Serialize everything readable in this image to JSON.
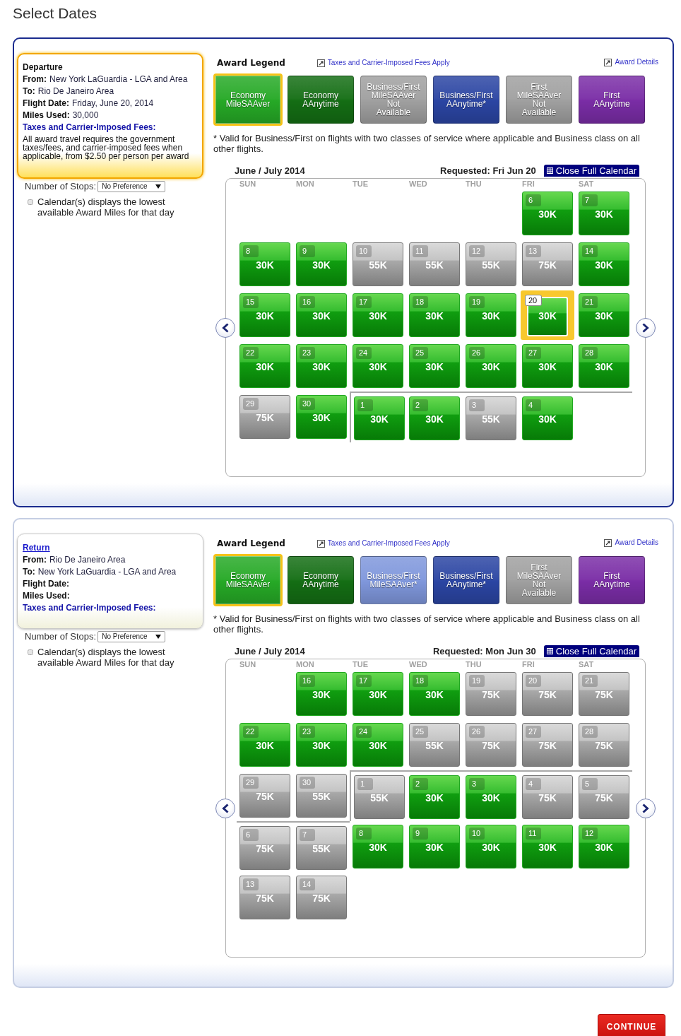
{
  "page": {
    "title": "Select Dates"
  },
  "sections": [
    {
      "selected": true,
      "info": {
        "heading": {
          "text": "Departure",
          "link": false
        },
        "fields": [
          {
            "label": "From:",
            "value": "New York LaGuardia - LGA and Area"
          },
          {
            "label": "To:",
            "value": "Rio De Janeiro Area"
          },
          {
            "label": "Flight Date:",
            "value": "Friday, June 20, 2014"
          },
          {
            "label": "Miles Used:",
            "value": "30,000"
          }
        ],
        "fees_label": "Taxes and Carrier-Imposed Fees:",
        "fees_note": "All award travel requires the government taxes/fees, and carrier-imposed fees when applicable, from $2.50 per person per award"
      },
      "stops": {
        "label": "Number of Stops:",
        "value": "No Preference"
      },
      "lowest_option": {
        "checked": false,
        "text": "Calendar(s) displays the lowest available Award Miles for that day"
      },
      "legend": {
        "title": "Award Legend",
        "fees_link": "Taxes and Carrier-Imposed Fees Apply",
        "details_link": "Award Details",
        "tiles": [
          {
            "label": "Economy MileSAAver",
            "color": "#26a926",
            "selected": true
          },
          {
            "label": "Economy AAnytime",
            "color": "#146e14",
            "selected": false
          },
          {
            "label": "Business/First MileSAAver Not Available",
            "color": "#a0a0a0",
            "selected": false
          },
          {
            "label": "Business/First AAnytime*",
            "color": "#2b45a3",
            "selected": false
          },
          {
            "label": "First MileSAAver Not Available",
            "color": "#a0a0a0",
            "selected": false
          },
          {
            "label": "First AAnytime",
            "color": "#7a2da6",
            "selected": false
          }
        ],
        "footnote": "* Valid for Business/First on flights with two classes of service where applicable and Business class on all other flights."
      },
      "calendar": {
        "title": "June / July 2014",
        "requested": "Requested: Fri Jun 20",
        "close_button": "Close Full Calendar",
        "weekdays": [
          "SUN",
          "MON",
          "TUE",
          "WED",
          "THU",
          "FRI",
          "SAT"
        ],
        "months": [
          {
            "days": [
              {
                "kind": "empty"
              },
              {
                "kind": "empty"
              },
              {
                "kind": "empty"
              },
              {
                "kind": "empty"
              },
              {
                "kind": "empty"
              },
              {
                "kind": "day",
                "day": "6",
                "miles": "30K",
                "saver": true,
                "selected": false
              },
              {
                "kind": "day",
                "day": "7",
                "miles": "30K",
                "saver": true,
                "selected": false
              },
              {
                "kind": "day",
                "day": "8",
                "miles": "30K",
                "saver": true,
                "selected": false
              },
              {
                "kind": "day",
                "day": "9",
                "miles": "30K",
                "saver": true,
                "selected": false
              },
              {
                "kind": "day",
                "day": "10",
                "miles": "55K",
                "saver": false,
                "selected": false
              },
              {
                "kind": "day",
                "day": "11",
                "miles": "55K",
                "saver": false,
                "selected": false
              },
              {
                "kind": "day",
                "day": "12",
                "miles": "55K",
                "saver": false,
                "selected": false
              },
              {
                "kind": "day",
                "day": "13",
                "miles": "75K",
                "saver": false,
                "selected": false
              },
              {
                "kind": "day",
                "day": "14",
                "miles": "30K",
                "saver": true,
                "selected": false
              },
              {
                "kind": "day",
                "day": "15",
                "miles": "30K",
                "saver": true,
                "selected": false
              },
              {
                "kind": "day",
                "day": "16",
                "miles": "30K",
                "saver": true,
                "selected": false
              },
              {
                "kind": "day",
                "day": "17",
                "miles": "30K",
                "saver": true,
                "selected": false
              },
              {
                "kind": "day",
                "day": "18",
                "miles": "30K",
                "saver": true,
                "selected": false
              },
              {
                "kind": "day",
                "day": "19",
                "miles": "30K",
                "saver": true,
                "selected": false
              },
              {
                "kind": "day",
                "day": "20",
                "miles": "30K",
                "saver": true,
                "selected": true
              },
              {
                "kind": "day",
                "day": "21",
                "miles": "30K",
                "saver": true,
                "selected": false
              },
              {
                "kind": "day",
                "day": "22",
                "miles": "30K",
                "saver": true,
                "selected": false
              },
              {
                "kind": "day",
                "day": "23",
                "miles": "30K",
                "saver": true,
                "selected": false
              },
              {
                "kind": "day",
                "day": "24",
                "miles": "30K",
                "saver": true,
                "selected": false
              },
              {
                "kind": "day",
                "day": "25",
                "miles": "30K",
                "saver": true,
                "selected": false
              },
              {
                "kind": "day",
                "day": "26",
                "miles": "30K",
                "saver": true,
                "selected": false
              },
              {
                "kind": "day",
                "day": "27",
                "miles": "30K",
                "saver": true,
                "selected": false
              },
              {
                "kind": "day",
                "day": "28",
                "miles": "30K",
                "saver": true,
                "selected": false
              },
              {
                "kind": "day",
                "day": "29",
                "miles": "75K",
                "saver": false,
                "selected": false
              },
              {
                "kind": "day",
                "day": "30",
                "miles": "30K",
                "saver": true,
                "selected": false
              }
            ]
          },
          {
            "days": [
              {
                "kind": "day",
                "day": "1",
                "miles": "30K",
                "saver": true,
                "selected": false
              },
              {
                "kind": "day",
                "day": "2",
                "miles": "30K",
                "saver": true,
                "selected": false
              },
              {
                "kind": "day",
                "day": "3",
                "miles": "55K",
                "saver": false,
                "selected": false
              },
              {
                "kind": "day",
                "day": "4",
                "miles": "30K",
                "saver": true,
                "selected": false
              }
            ]
          }
        ]
      }
    },
    {
      "selected": false,
      "info": {
        "heading": {
          "text": "Return",
          "link": true
        },
        "fields": [
          {
            "label": "From:",
            "value": "Rio De Janeiro Area"
          },
          {
            "label": "To:",
            "value": "New York LaGuardia - LGA and Area"
          },
          {
            "label": "Flight Date:"
          },
          {
            "label": "Miles Used:"
          }
        ],
        "fees_label": "Taxes and Carrier-Imposed Fees:"
      },
      "stops": {
        "label": "Number of Stops:",
        "value": "No Preference"
      },
      "lowest_option": {
        "checked": false,
        "text": "Calendar(s) displays the lowest available Award Miles for that day"
      },
      "legend": {
        "title": "Award Legend",
        "fees_link": "Taxes and Carrier-Imposed Fees Apply",
        "details_link": "Award Details",
        "tiles": [
          {
            "label": "Economy MileSAAver",
            "color": "#26a926",
            "selected": true
          },
          {
            "label": "Economy AAnytime",
            "color": "#146e14",
            "selected": false
          },
          {
            "label": "Business/First MileSAAver*",
            "color": "#7f97dc",
            "selected": false
          },
          {
            "label": "Business/First AAnytime*",
            "color": "#2b45a3",
            "selected": false
          },
          {
            "label": "First MileSAAver Not Available",
            "color": "#a0a0a0",
            "selected": false
          },
          {
            "label": "First AAnytime",
            "color": "#7a2da6",
            "selected": false
          }
        ],
        "footnote": "* Valid for Business/First on flights with two classes of service where applicable and Business class on all other flights."
      },
      "calendar": {
        "title": "June / July 2014",
        "requested": "Requested: Mon Jun 30",
        "close_button": "Close Full Calendar",
        "weekdays": [
          "SUN",
          "MON",
          "TUE",
          "WED",
          "THU",
          "FRI",
          "SAT"
        ],
        "months": [
          {
            "days": [
              {
                "kind": "empty"
              },
              {
                "kind": "day",
                "day": "16",
                "miles": "30K",
                "saver": true,
                "selected": false
              },
              {
                "kind": "day",
                "day": "17",
                "miles": "30K",
                "saver": true,
                "selected": false
              },
              {
                "kind": "day",
                "day": "18",
                "miles": "30K",
                "saver": true,
                "selected": false
              },
              {
                "kind": "day",
                "day": "19",
                "miles": "75K",
                "saver": false,
                "selected": false
              },
              {
                "kind": "day",
                "day": "20",
                "miles": "75K",
                "saver": false,
                "selected": false
              },
              {
                "kind": "day",
                "day": "21",
                "miles": "75K",
                "saver": false,
                "selected": false
              },
              {
                "kind": "day",
                "day": "22",
                "miles": "30K",
                "saver": true,
                "selected": false
              },
              {
                "kind": "day",
                "day": "23",
                "miles": "30K",
                "saver": true,
                "selected": false
              },
              {
                "kind": "day",
                "day": "24",
                "miles": "30K",
                "saver": true,
                "selected": false
              },
              {
                "kind": "day",
                "day": "25",
                "miles": "55K",
                "saver": false,
                "selected": false
              },
              {
                "kind": "day",
                "day": "26",
                "miles": "75K",
                "saver": false,
                "selected": false
              },
              {
                "kind": "day",
                "day": "27",
                "miles": "75K",
                "saver": false,
                "selected": false
              },
              {
                "kind": "day",
                "day": "28",
                "miles": "75K",
                "saver": false,
                "selected": false
              },
              {
                "kind": "day",
                "day": "29",
                "miles": "75K",
                "saver": false,
                "selected": false
              },
              {
                "kind": "day",
                "day": "30",
                "miles": "55K",
                "saver": false,
                "selected": false
              }
            ]
          },
          {
            "days": [
              {
                "kind": "day",
                "day": "1",
                "miles": "55K",
                "saver": false,
                "selected": false
              },
              {
                "kind": "day",
                "day": "2",
                "miles": "30K",
                "saver": true,
                "selected": false
              },
              {
                "kind": "day",
                "day": "3",
                "miles": "30K",
                "saver": true,
                "selected": false
              },
              {
                "kind": "day",
                "day": "4",
                "miles": "75K",
                "saver": false,
                "selected": false
              },
              {
                "kind": "day",
                "day": "5",
                "miles": "75K",
                "saver": false,
                "selected": false
              },
              {
                "kind": "day",
                "day": "6",
                "miles": "75K",
                "saver": false,
                "selected": false
              },
              {
                "kind": "day",
                "day": "7",
                "miles": "55K",
                "saver": false,
                "selected": false
              },
              {
                "kind": "day",
                "day": "8",
                "miles": "30K",
                "saver": true,
                "selected": false
              },
              {
                "kind": "day",
                "day": "9",
                "miles": "30K",
                "saver": true,
                "selected": false
              },
              {
                "kind": "day",
                "day": "10",
                "miles": "30K",
                "saver": true,
                "selected": false
              },
              {
                "kind": "day",
                "day": "11",
                "miles": "30K",
                "saver": true,
                "selected": false
              },
              {
                "kind": "day",
                "day": "12",
                "miles": "30K",
                "saver": true,
                "selected": false
              },
              {
                "kind": "day",
                "day": "13",
                "miles": "75K",
                "saver": false,
                "selected": false
              },
              {
                "kind": "day",
                "day": "14",
                "miles": "75K",
                "saver": false,
                "selected": false
              }
            ]
          }
        ]
      }
    }
  ],
  "continue_button": "CONTINUE"
}
